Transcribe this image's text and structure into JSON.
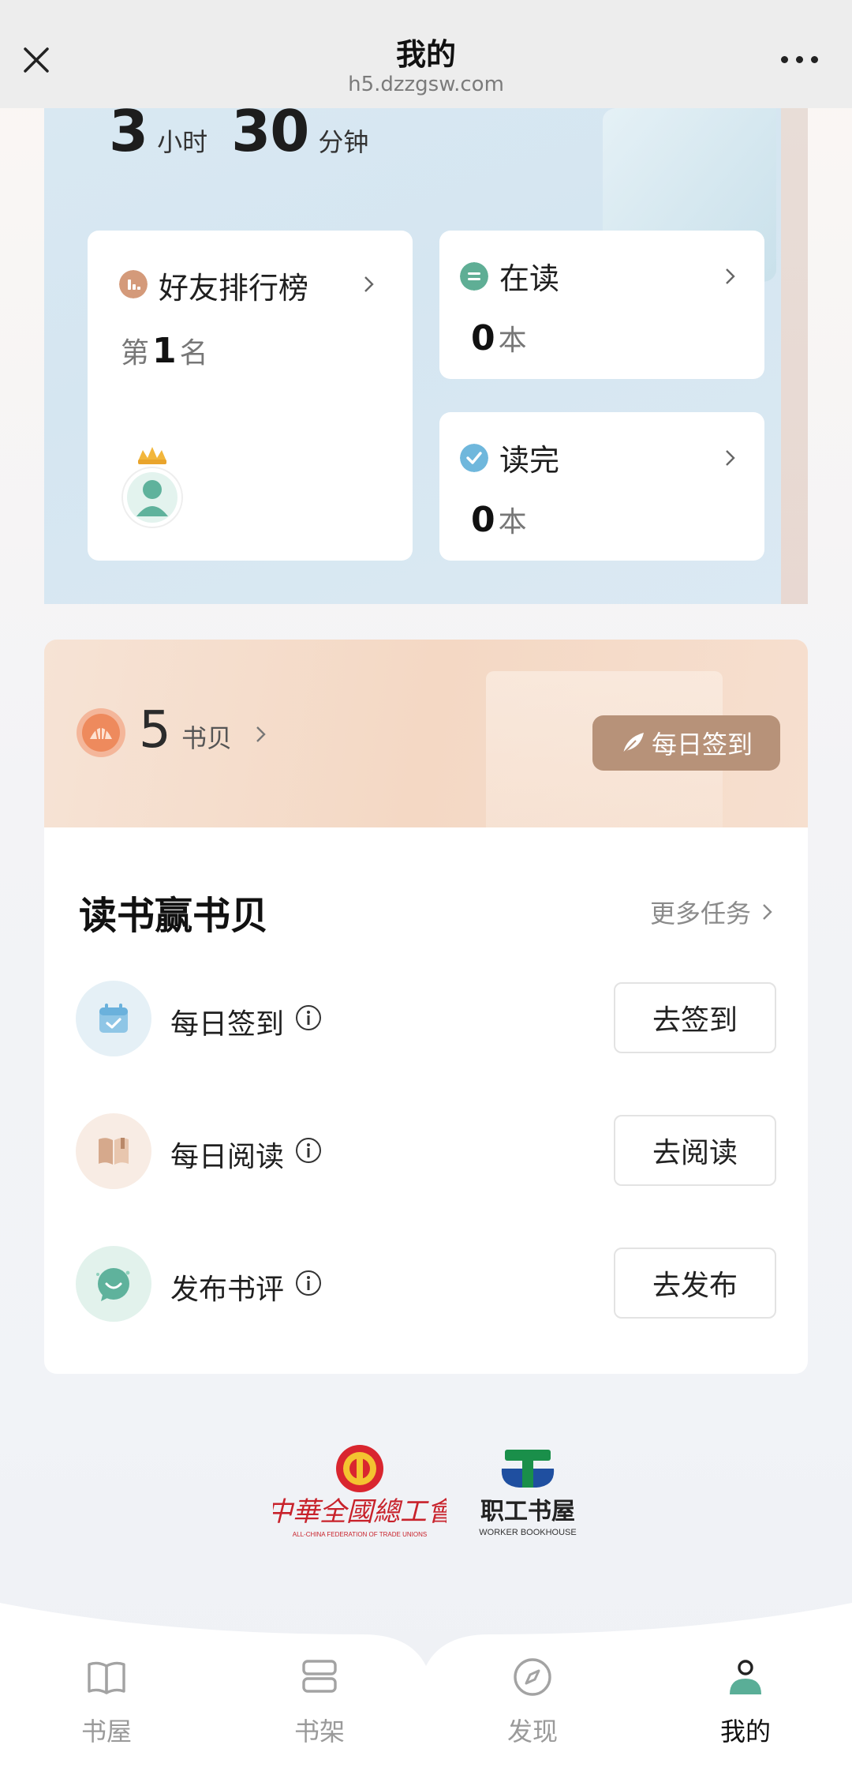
{
  "nav": {
    "title": "我的",
    "url": "h5.dzzgsw.com"
  },
  "stats": {
    "hours": "3",
    "hours_unit": "小时",
    "minutes": "30",
    "minutes_unit": "分钟"
  },
  "cards": {
    "ranking": {
      "title": "好友排行榜",
      "prefix": "第",
      "rank": "1",
      "suffix": "名"
    },
    "reading": {
      "title": "在读",
      "count": "0",
      "unit": "本"
    },
    "finished": {
      "title": "读完",
      "count": "0",
      "unit": "本"
    }
  },
  "coins": {
    "count": "5",
    "label": "书贝",
    "checkin_button": "每日签到"
  },
  "tasks": {
    "title": "读书赢书贝",
    "more": "更多任务",
    "items": [
      {
        "label": "每日签到",
        "button": "去签到",
        "icon": "calendar-icon"
      },
      {
        "label": "每日阅读",
        "button": "去阅读",
        "icon": "book-icon"
      },
      {
        "label": "发布书评",
        "button": "去发布",
        "icon": "chat-icon"
      }
    ]
  },
  "logos": {
    "acftu_cn": "中華全國總工會",
    "acftu_en": "ALL-CHINA FEDERATION OF TRADE UNIONS",
    "worker_cn": "职工书屋",
    "worker_en": "WORKER BOOKHOUSE"
  },
  "tabbar": {
    "items": [
      {
        "label": "书屋",
        "icon": "book-open-icon"
      },
      {
        "label": "书架",
        "icon": "bookshelf-icon"
      },
      {
        "label": "发现",
        "icon": "compass-icon"
      },
      {
        "label": "我的",
        "icon": "user-icon",
        "active": true
      }
    ]
  },
  "colors": {
    "accent_brown": "#b79279",
    "nav_bg": "#ededed",
    "stats_bg": "#d5e6f1",
    "active_tab_teal": "#5aae97"
  }
}
